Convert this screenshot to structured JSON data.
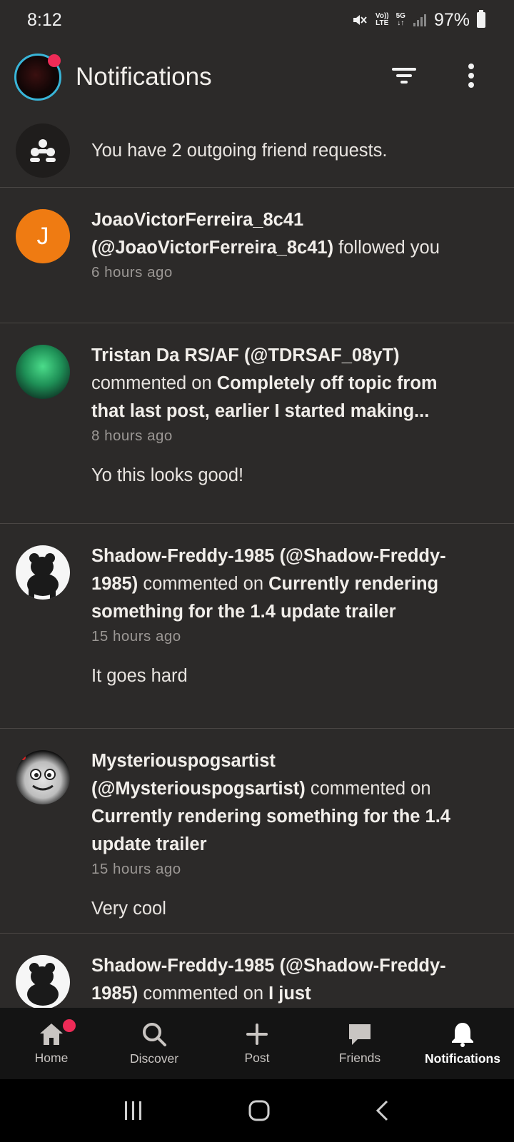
{
  "status": {
    "time": "8:12",
    "battery": "97%",
    "net_top": "Vo))",
    "net_bottom": "LTE",
    "net_5g": "5G"
  },
  "header": {
    "title": "Notifications"
  },
  "friend_requests": {
    "text": "You have 2 outgoing friend requests."
  },
  "notifications": [
    {
      "avatar_letter": "J",
      "bold1": "JoaoVictorFerreira_8c41 (@JoaoVictorFerreira_8c41)",
      "text": " followed you",
      "time": "6 hours ago"
    },
    {
      "bold1": "Tristan Da RS/AF (@TDRSAF_08yT)",
      "text": " commented on ",
      "bold2": "Completely off topic from that last post, earlier I started making...",
      "time": "8 hours ago",
      "comment": "Yo this looks good!"
    },
    {
      "bold1": "Shadow-Freddy-1985 (@Shadow-Freddy-1985)",
      "text": " commented on ",
      "bold2": "Currently rendering something for the 1.4 update trailer",
      "time": "15 hours ago",
      "comment": "It goes hard"
    },
    {
      "bold1": "Mysteriouspogsartist (@Mysteriouspogsartist)",
      "text": " commented on ",
      "bold2": "Currently rendering something for the 1.4 update trailer",
      "time": "15 hours ago",
      "comment": "Very cool"
    },
    {
      "bold1": "Shadow-Freddy-1985 (@Shadow-Freddy-1985)",
      "text": " commented on ",
      "bold2": "I just"
    }
  ],
  "nav": [
    {
      "label": "Home"
    },
    {
      "label": "Discover"
    },
    {
      "label": "Post"
    },
    {
      "label": "Friends"
    },
    {
      "label": "Notifications"
    }
  ],
  "colors": {
    "accent_dot": "#ee2b57",
    "avatar_orange": "#ef7b12",
    "background": "#2c2a29"
  }
}
